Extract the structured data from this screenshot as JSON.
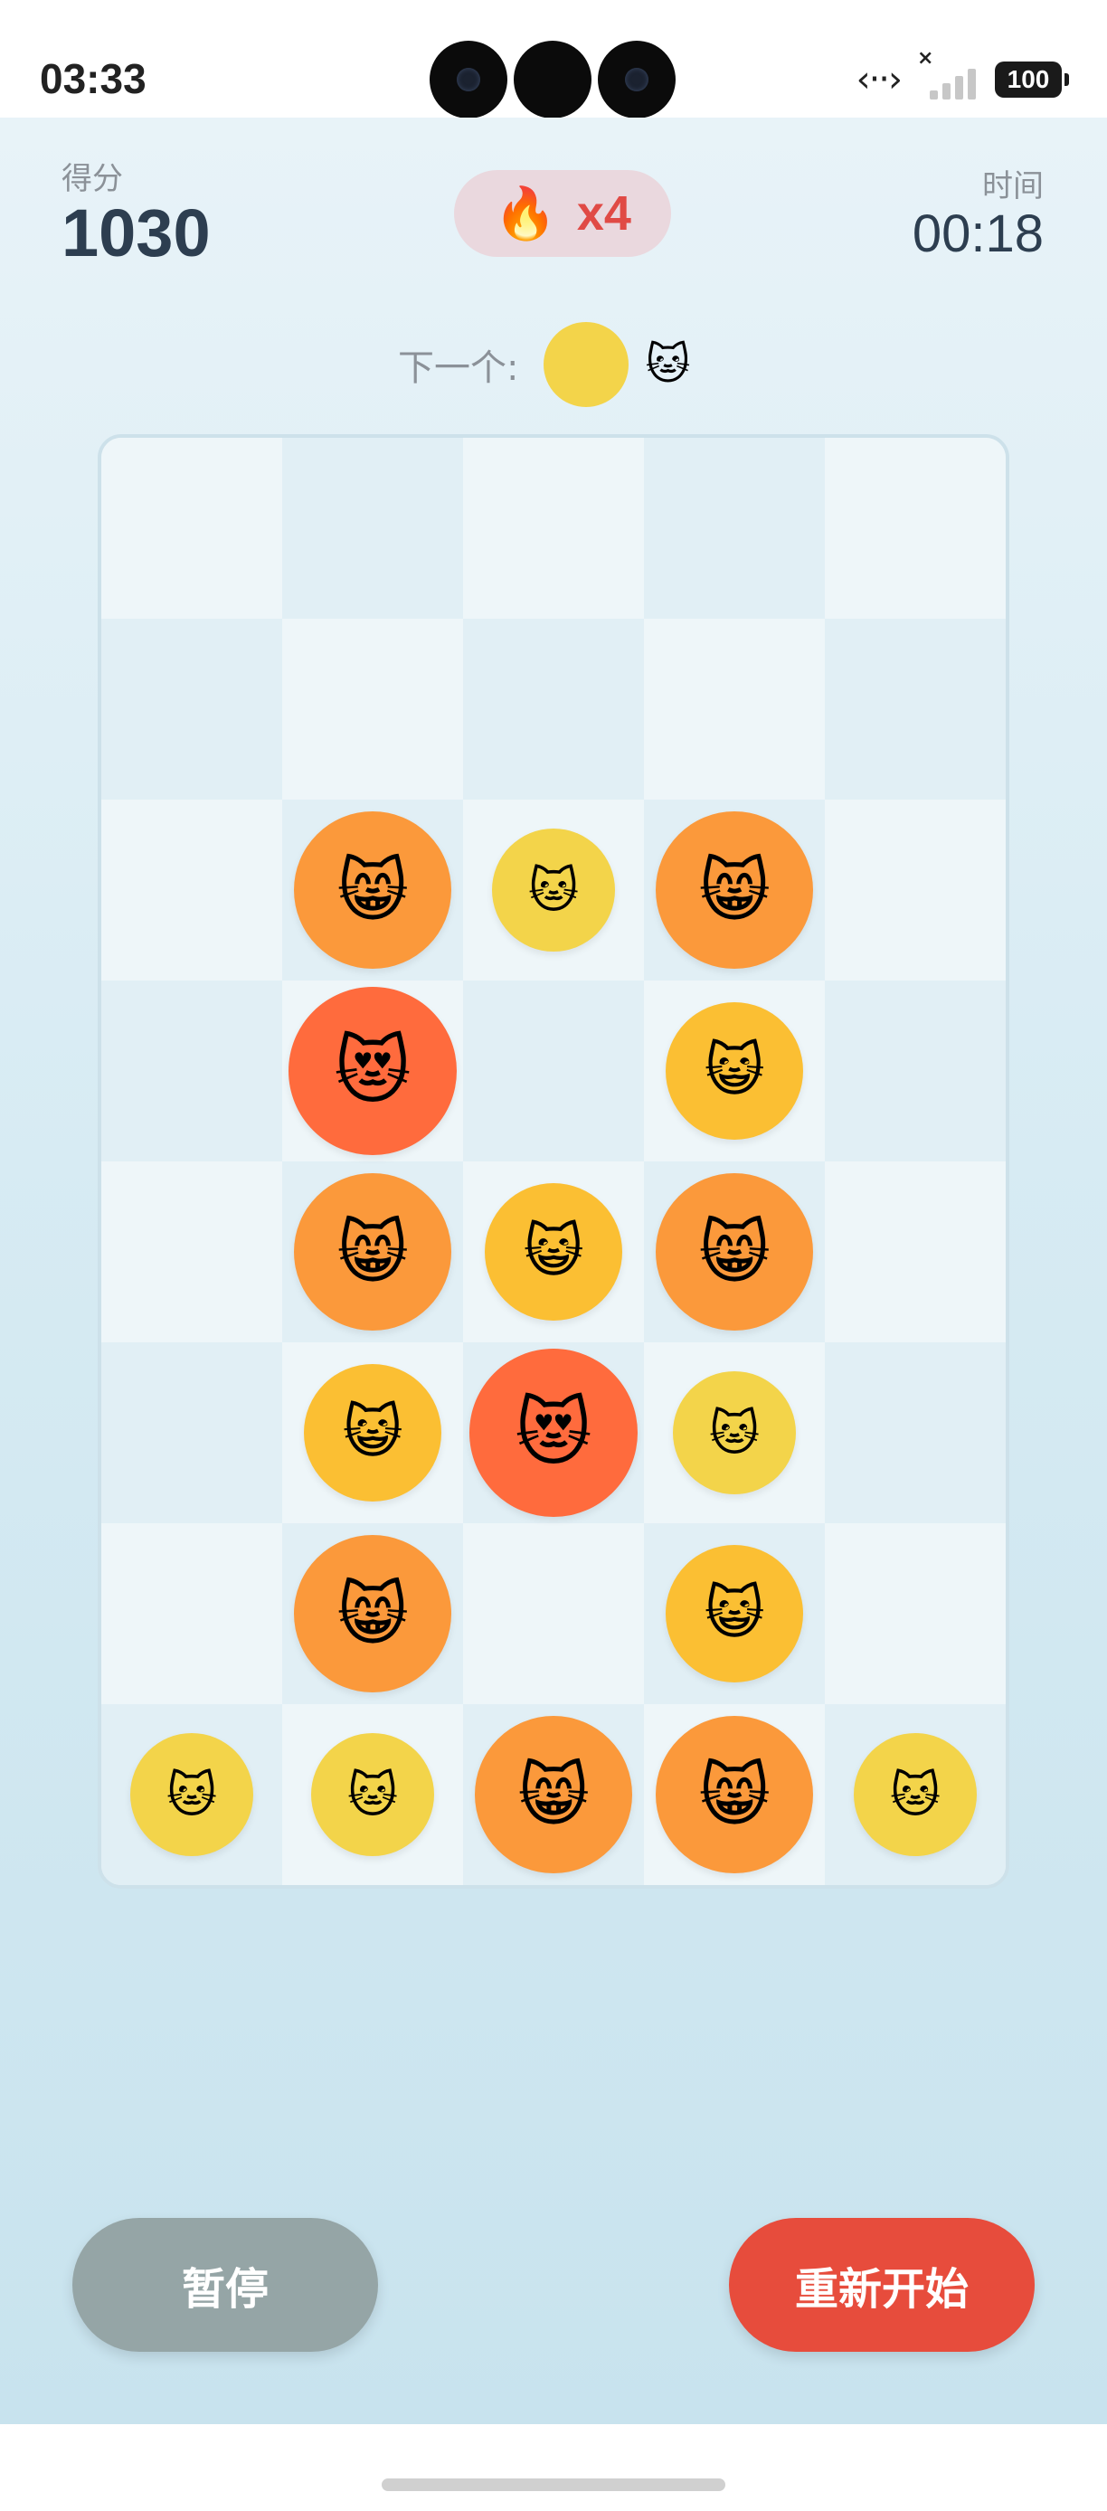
{
  "status_bar": {
    "time": "03:33",
    "data_icon": "data-transfer-icon",
    "battery": "100"
  },
  "header": {
    "score_label": "得分",
    "score": "1030",
    "combo_icon": "🔥",
    "combo": "x4",
    "time_label": "时间",
    "time": "00:18"
  },
  "next": {
    "label": "下一个:",
    "color": "#f3d44a",
    "emoji": "🐱"
  },
  "board": {
    "rows": 8,
    "cols": 5,
    "pieces": [
      {
        "row": 2,
        "col": 1,
        "level": 3,
        "emoji": "😸"
      },
      {
        "row": 2,
        "col": 2,
        "level": 1,
        "emoji": "🐱"
      },
      {
        "row": 2,
        "col": 3,
        "level": 3,
        "emoji": "😸"
      },
      {
        "row": 3,
        "col": 1,
        "level": 4,
        "emoji": "😻"
      },
      {
        "row": 3,
        "col": 3,
        "level": 2,
        "emoji": "😺"
      },
      {
        "row": 4,
        "col": 1,
        "level": 3,
        "emoji": "😸"
      },
      {
        "row": 4,
        "col": 2,
        "level": 2,
        "emoji": "😺"
      },
      {
        "row": 4,
        "col": 3,
        "level": 3,
        "emoji": "😸"
      },
      {
        "row": 5,
        "col": 1,
        "level": 2,
        "emoji": "😺"
      },
      {
        "row": 5,
        "col": 2,
        "level": 4,
        "emoji": "😻"
      },
      {
        "row": 5,
        "col": 3,
        "level": 1,
        "emoji": "🐱"
      },
      {
        "row": 6,
        "col": 1,
        "level": 3,
        "emoji": "😸"
      },
      {
        "row": 6,
        "col": 3,
        "level": 2,
        "emoji": "😺"
      },
      {
        "row": 7,
        "col": 0,
        "level": 1,
        "emoji": "🐱"
      },
      {
        "row": 7,
        "col": 1,
        "level": 1,
        "emoji": "🐱"
      },
      {
        "row": 7,
        "col": 2,
        "level": 3,
        "emoji": "😸"
      },
      {
        "row": 7,
        "col": 3,
        "level": 3,
        "emoji": "😸"
      },
      {
        "row": 7,
        "col": 4,
        "level": 1,
        "emoji": "🐱"
      }
    ]
  },
  "levels": {
    "1": {
      "color": "#f3d44a"
    },
    "2": {
      "color": "#fbbf33"
    },
    "3": {
      "color": "#fb993b"
    },
    "4": {
      "color": "#ff6b3d"
    }
  },
  "buttons": {
    "pause": "暂停",
    "restart": "重新开始"
  },
  "colors": {
    "pause_button": "#95a5a6",
    "restart_button": "#e74c3c",
    "score_text": "#2d3e50",
    "combo_text": "#e04a45"
  }
}
